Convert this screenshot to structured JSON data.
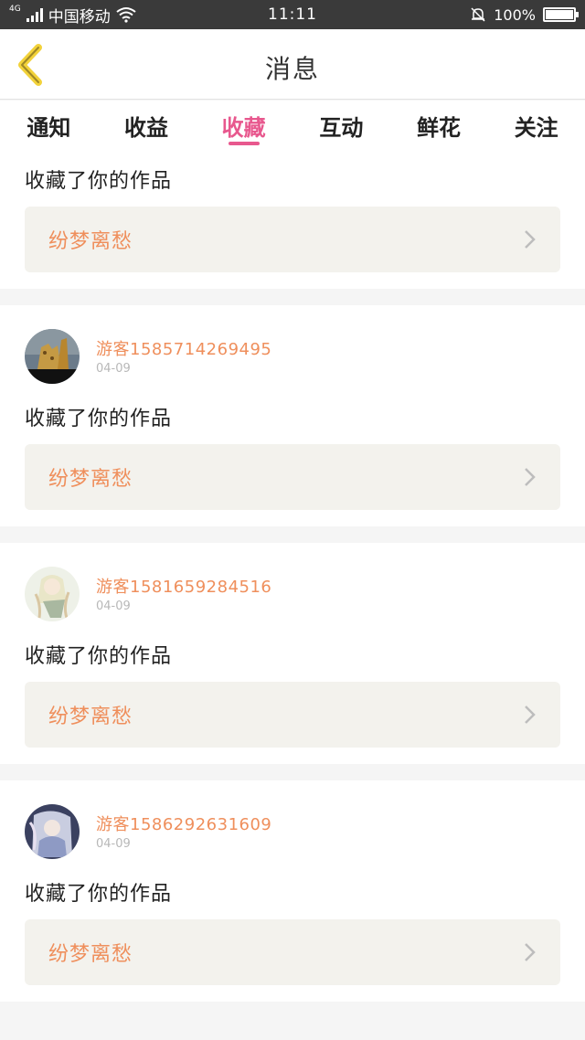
{
  "status_bar": {
    "network": "4G",
    "carrier": "中国移动",
    "time": "11:11",
    "battery": "100%"
  },
  "header": {
    "title": "消息",
    "back_icon": "chevron-left-icon"
  },
  "tabs": [
    {
      "label": "通知",
      "active": false
    },
    {
      "label": "收益",
      "active": false
    },
    {
      "label": "收藏",
      "active": true
    },
    {
      "label": "互动",
      "active": false
    },
    {
      "label": "鲜花",
      "active": false
    },
    {
      "label": "关注",
      "active": false
    }
  ],
  "colors": {
    "accent": "#e8588e",
    "username": "#ef8f5c",
    "work_box_bg": "#f3f2ed"
  },
  "feed": {
    "first": {
      "action": "收藏了你的作品",
      "work": "纷梦离愁"
    },
    "items": [
      {
        "username": "游客1585714269495",
        "date": "04-09",
        "action": "收藏了你的作品",
        "work": "纷梦离愁"
      },
      {
        "username": "游客1581659284516",
        "date": "04-09",
        "action": "收藏了你的作品",
        "work": "纷梦离愁"
      },
      {
        "username": "游客1586292631609",
        "date": "04-09",
        "action": "收藏了你的作品",
        "work": "纷梦离愁"
      }
    ]
  }
}
